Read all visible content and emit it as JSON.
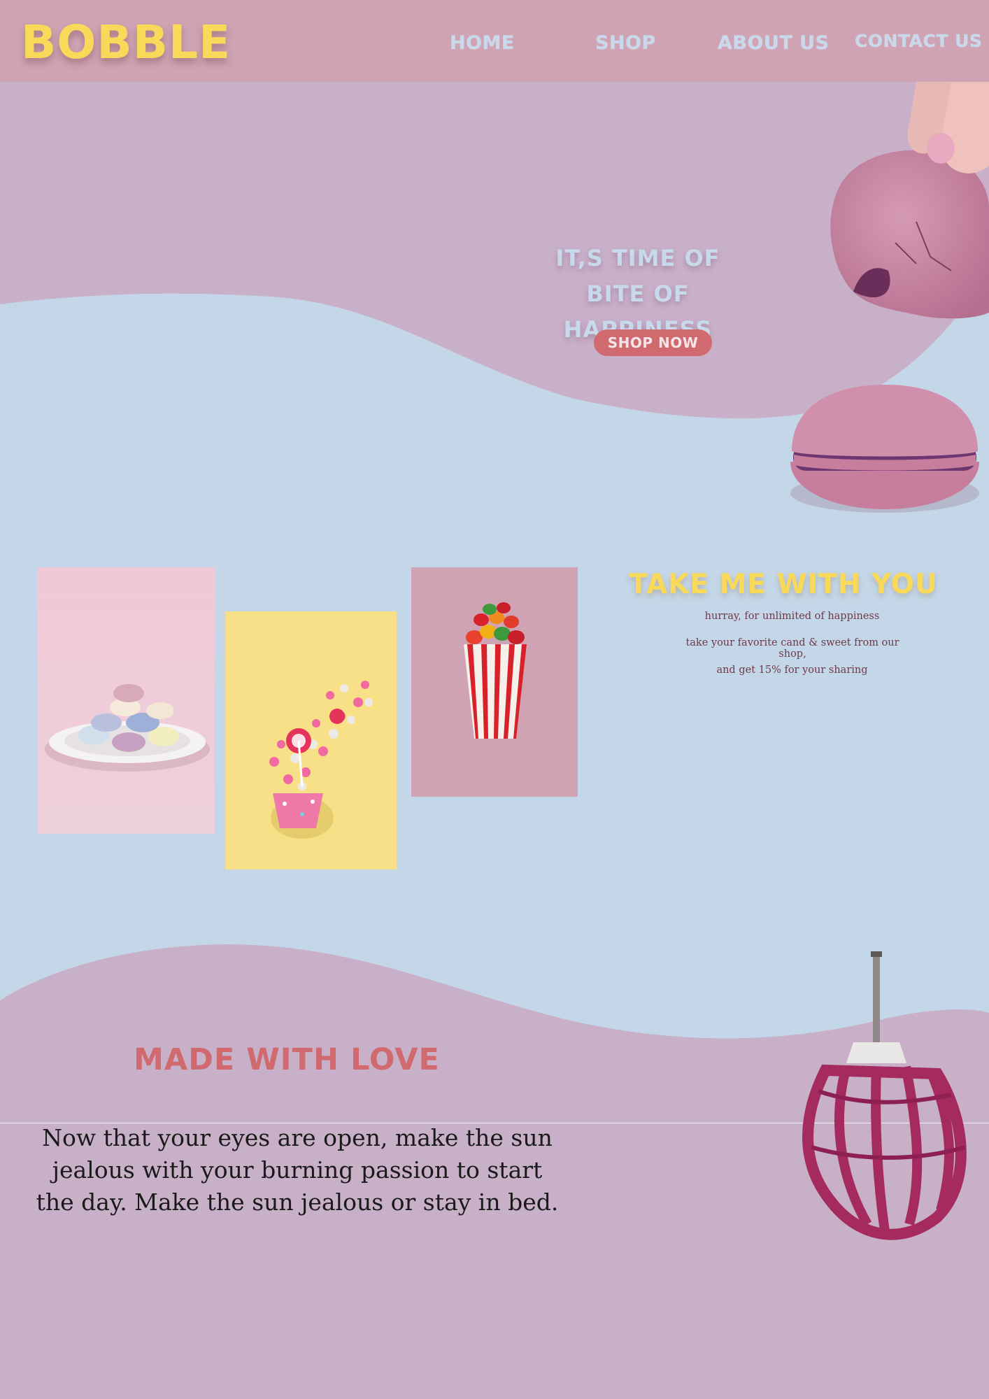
{
  "brand": {
    "logo": "BOBBLE"
  },
  "nav": {
    "items": [
      {
        "label": "HOME"
      },
      {
        "label": "SHOP"
      },
      {
        "label": "ABOUT US"
      },
      {
        "label": "CONTACT US"
      }
    ]
  },
  "hero": {
    "title_line1": "IT,S TIME OF",
    "title_line2": "BITE OF HAPPINESS",
    "cta_label": "SHOP NOW"
  },
  "promo": {
    "title": "TAKE ME WITH YOU",
    "line1": "hurray, for unlimited of happiness",
    "line2": "take your favorite cand & sweet from our shop,",
    "line3": "and get 15% for your sharing"
  },
  "story": {
    "title": "MADE WITH LOVE",
    "body": "Now that your eyes are open, make the sun jealous with your burning passion to start the day. Make the sun jealous or stay in bed."
  },
  "images": {
    "gallery": [
      "macarons-plate-image",
      "candy-cup-image",
      "gummy-popcorn-image"
    ],
    "decor": [
      "bitten-macaron-image",
      "macaron-image",
      "whisk-image"
    ]
  },
  "colors": {
    "header_bg": "#cfa3b3",
    "page_bg": "#c4d7e8",
    "wave_bg": "#c9b0c9",
    "logo": "#f8d95a",
    "nav_text": "#c7d9ea",
    "cta_bg": "#d06a6e",
    "accent_red": "#d06a6e"
  }
}
